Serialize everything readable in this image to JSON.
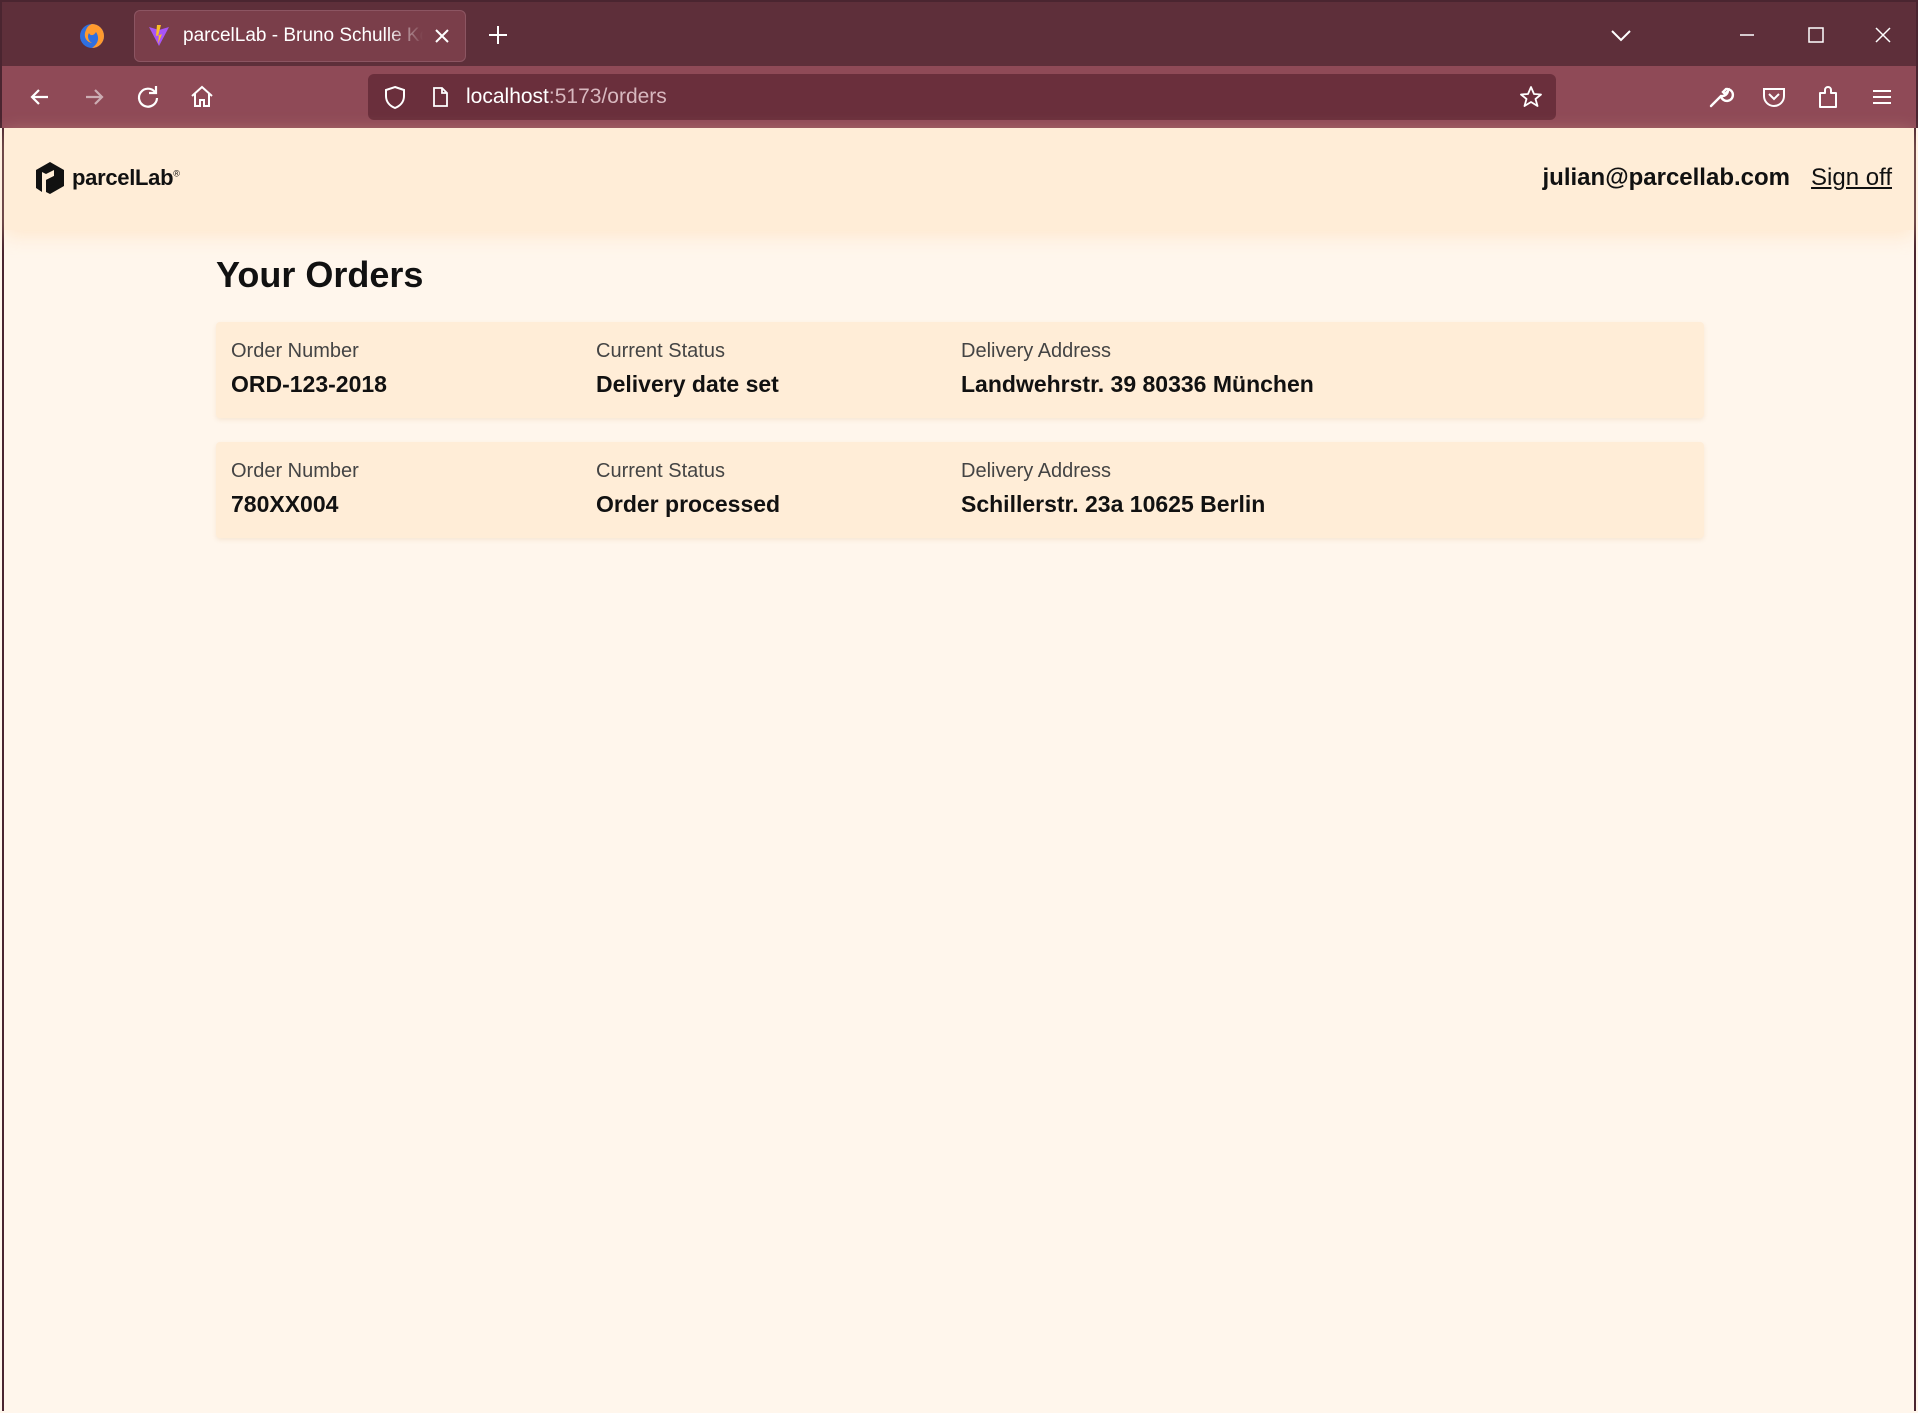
{
  "browser": {
    "tab": {
      "title": "parcelLab - Bruno Schulle Konrad"
    },
    "url": {
      "host": "localhost",
      "path": ":5173/orders"
    }
  },
  "header": {
    "logo_text": "parcelLab",
    "logo_reg": "®",
    "user_email": "julian@parcellab.com",
    "sign_off_label": "Sign off"
  },
  "main": {
    "title": "Your Orders",
    "labels": {
      "order_number": "Order Number",
      "current_status": "Current Status",
      "delivery_address": "Delivery Address"
    },
    "orders": [
      {
        "number": "ORD-123-2018",
        "status": "Delivery date set",
        "address": "Landwehrstr. 39 80336 München"
      },
      {
        "number": "780XX004",
        "status": "Order processed",
        "address": "Schillerstr. 23a 10625 Berlin"
      }
    ]
  },
  "colors": {
    "tabbar_bg": "#5e2f3a",
    "navbar_bg": "#8f4a57",
    "header_bg": "#ffedd7",
    "page_bg": "#fff6ec",
    "card_bg": "#ffedd7"
  }
}
